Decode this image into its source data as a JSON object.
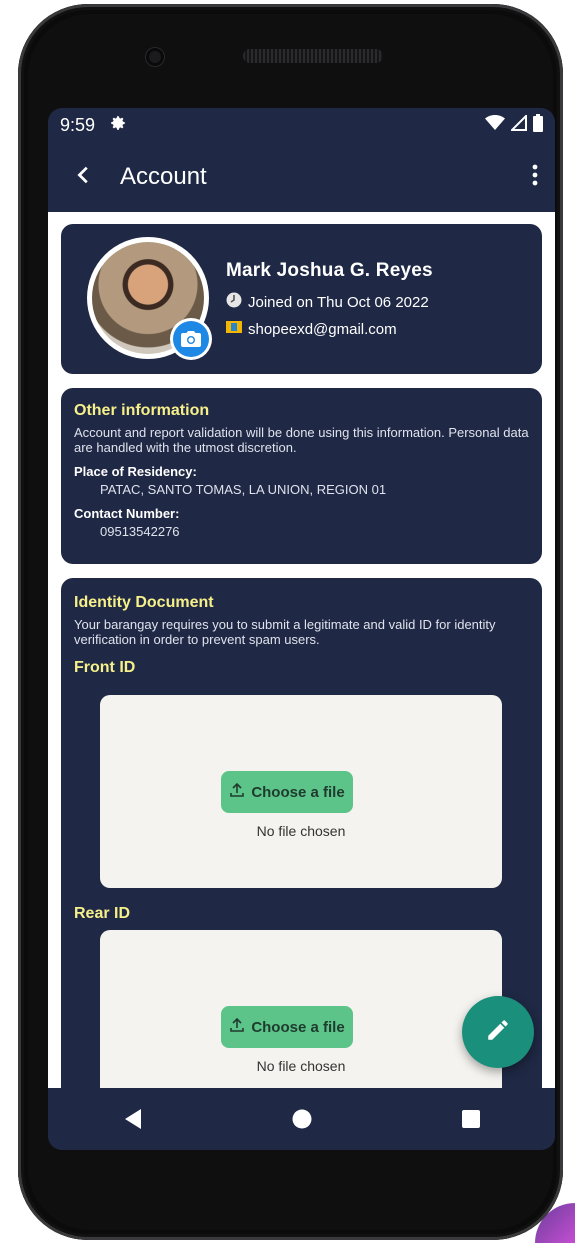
{
  "status_bar": {
    "time": "9:59"
  },
  "app_bar": {
    "title": "Account"
  },
  "profile": {
    "name": "Mark Joshua G. Reyes",
    "joined": "Joined on Thu Oct 06 2022",
    "email": "shopeexd@gmail.com"
  },
  "other_info": {
    "title": "Other information",
    "description": "Account and report validation will be done using this information. Personal data are handled with the utmost discretion.",
    "residency_label": "Place of Residency:",
    "residency_value": "PATAC, SANTO TOMAS, LA UNION, REGION 01",
    "contact_label": "Contact Number:",
    "contact_value": "09513542276"
  },
  "identity": {
    "title": "Identity Document",
    "description": "Your barangay requires you to submit a legitimate and valid ID for identity verification in order to prevent spam users.",
    "front_label": "Front ID",
    "rear_label": "Rear ID",
    "choose_label": "Choose a file",
    "no_file": "No file chosen"
  },
  "colors": {
    "primary_dark": "#1f2844",
    "accent_yellow": "#f6f08a",
    "upload_button": "#5cc489",
    "fab": "#1a8f7c",
    "camera_badge": "#1e88e5"
  },
  "icons": [
    "settings-icon",
    "wifi-icon",
    "signal-icon",
    "battery-icon",
    "back-icon",
    "more-icon",
    "camera-icon",
    "clock-icon",
    "email-icon",
    "upload-icon",
    "edit-icon",
    "nav-back-icon",
    "nav-home-icon",
    "nav-recents-icon"
  ]
}
